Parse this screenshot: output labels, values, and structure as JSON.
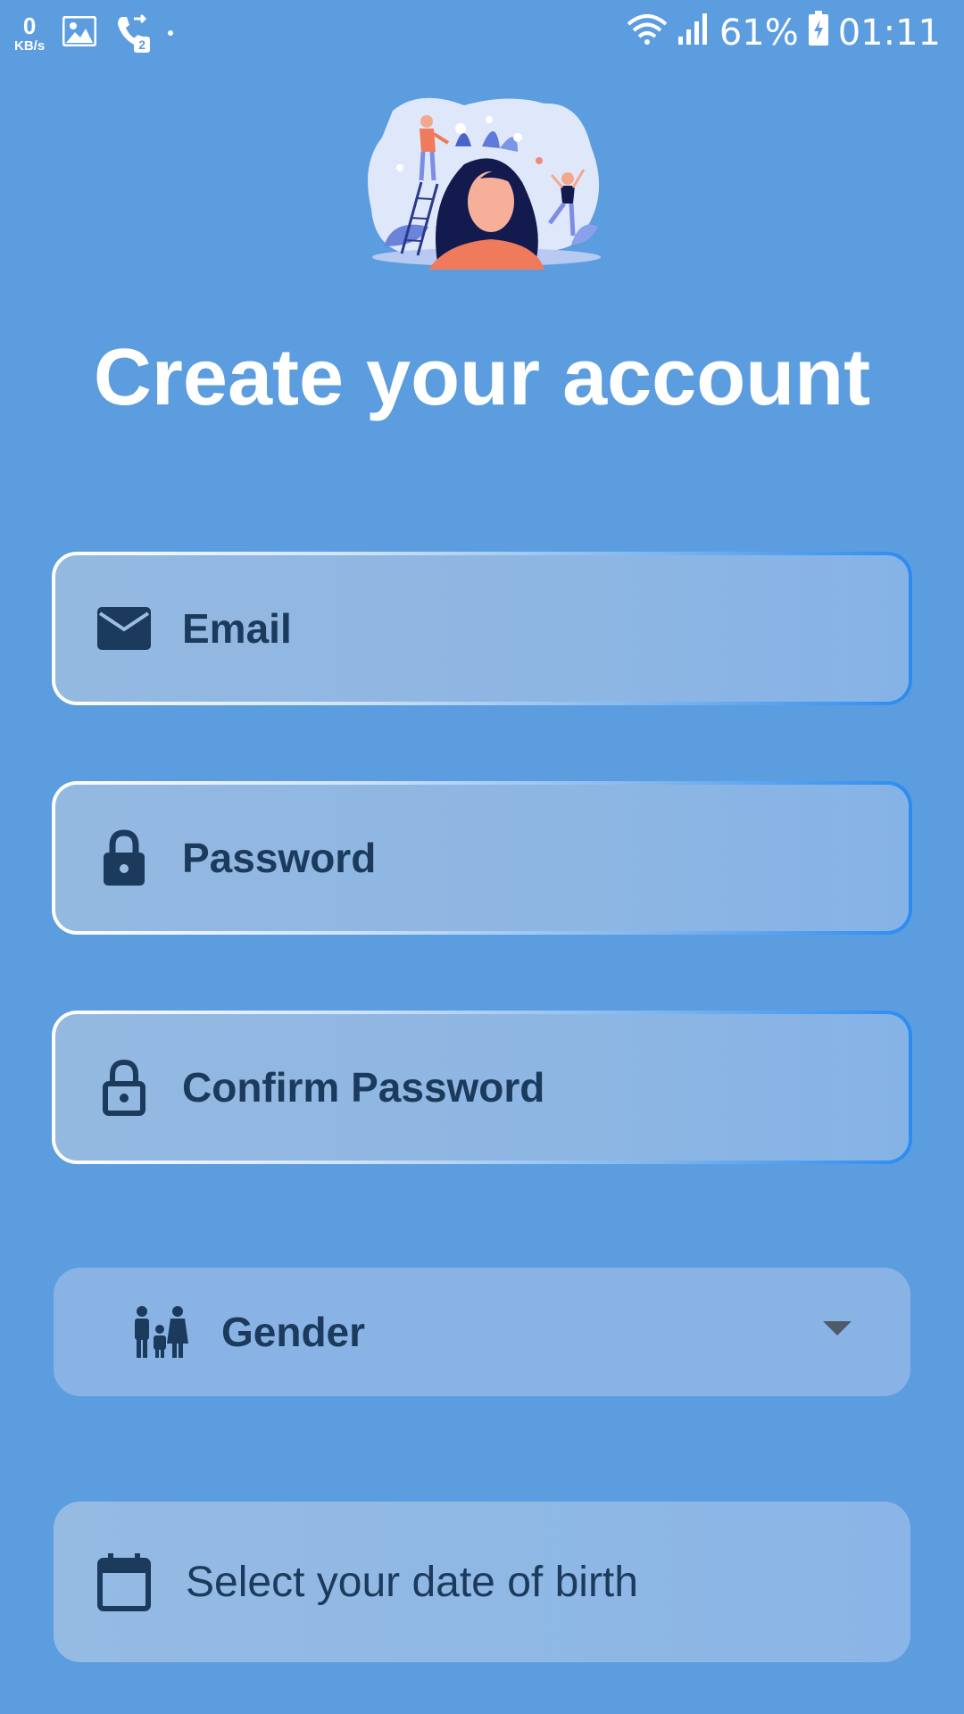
{
  "status_bar": {
    "net_speed_value": "0",
    "net_speed_unit": "KB/s",
    "sim_badge": "2",
    "battery": "61%",
    "time": "01:11"
  },
  "header": {
    "title": "Create your account"
  },
  "form": {
    "email": {
      "placeholder": "Email",
      "icon": "mail-icon"
    },
    "password": {
      "placeholder": "Password",
      "icon": "lock-icon"
    },
    "confirm_password": {
      "placeholder": "Confirm Password",
      "icon": "lock-outline-icon"
    },
    "gender": {
      "label": "Gender",
      "icon": "family-icon"
    },
    "date_of_birth": {
      "label": "Select your date of birth",
      "icon": "calendar-icon"
    }
  },
  "colors": {
    "background": "#5c9ddf",
    "title": "#ffffff",
    "field_text": "#1b3a5c",
    "field_border_accent": "#2b8cf0"
  }
}
